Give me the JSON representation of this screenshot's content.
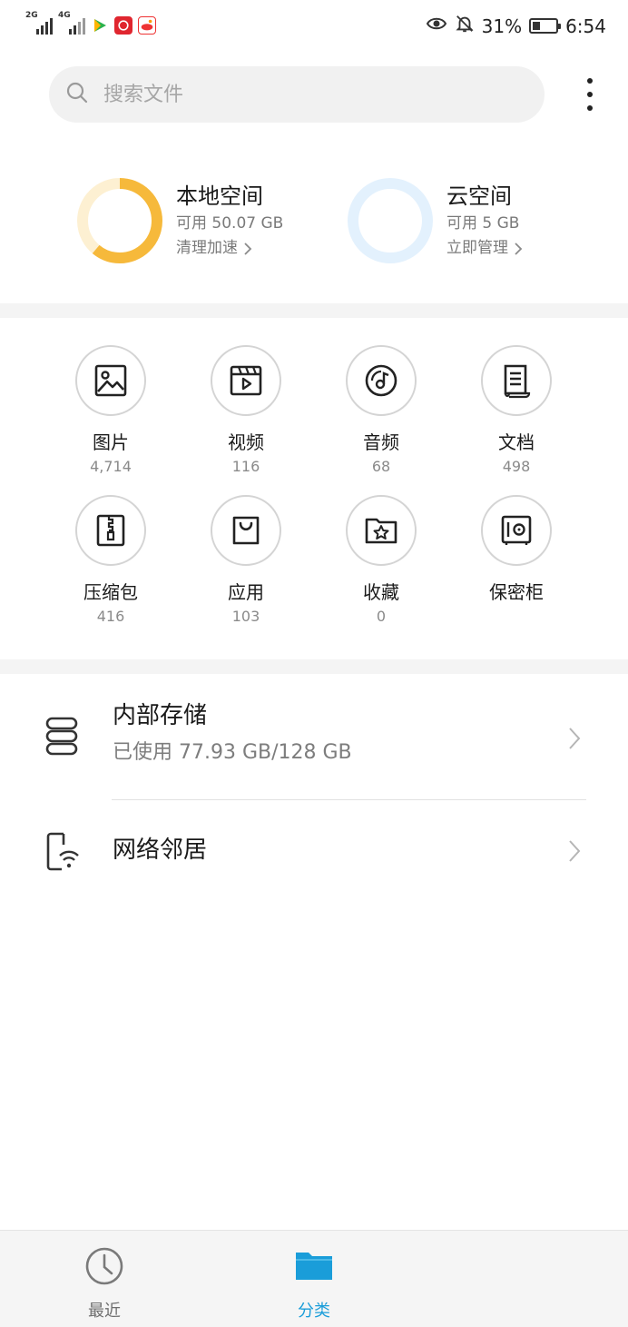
{
  "status_bar": {
    "signal1_tag": "2G",
    "signal2_tag": "4G",
    "battery_percent": "31%",
    "battery_level": 0.31,
    "time": "6:54",
    "app_icons": [
      "video-app-icon",
      "netease-music-icon",
      "sina-icon"
    ]
  },
  "search": {
    "placeholder": "搜索文件"
  },
  "storage_summary": {
    "local": {
      "title": "本地空间",
      "available": "可用 50.07 GB",
      "action": "清理加速",
      "used_fraction": 0.61,
      "color": "#f6b93b",
      "track_color": "#fdf0d2"
    },
    "cloud": {
      "title": "云空间",
      "available": "可用 5 GB",
      "action": "立即管理",
      "used_fraction": 0.0,
      "color": "#4da3ff",
      "track_color": "#e3f1fd"
    }
  },
  "categories": [
    {
      "label": "图片",
      "count": "4,714",
      "icon": "image-icon"
    },
    {
      "label": "视频",
      "count": "116",
      "icon": "video-icon"
    },
    {
      "label": "音频",
      "count": "68",
      "icon": "audio-icon"
    },
    {
      "label": "文档",
      "count": "498",
      "icon": "document-icon"
    },
    {
      "label": "压缩包",
      "count": "416",
      "icon": "archive-icon"
    },
    {
      "label": "应用",
      "count": "103",
      "icon": "app-bag-icon"
    },
    {
      "label": "收藏",
      "count": "0",
      "icon": "favorite-icon"
    },
    {
      "label": "保密柜",
      "count": "",
      "icon": "safe-icon"
    }
  ],
  "storage_list": {
    "internal": {
      "title": "内部存储",
      "usage": "已使用 77.93 GB/128 GB"
    },
    "network": {
      "title": "网络邻居"
    }
  },
  "bottom_nav": [
    {
      "label": "最近",
      "icon": "clock-icon",
      "active": false
    },
    {
      "label": "分类",
      "icon": "folder-icon",
      "active": true
    }
  ],
  "colors": {
    "accent": "#1a9dd9"
  }
}
